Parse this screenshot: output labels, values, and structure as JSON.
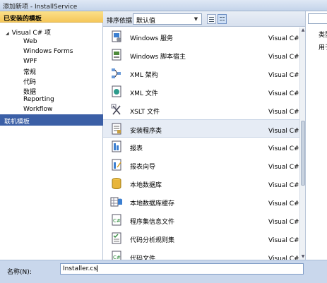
{
  "window": {
    "title": "添加新项 - InstallService"
  },
  "left_panel": {
    "installed_header": "已安装的模板",
    "root": "Visual C# 项",
    "children": [
      "Web",
      "Windows Forms",
      "WPF",
      "常规",
      "代码",
      "数据",
      "Reporting",
      "Workflow"
    ],
    "online": "联机模板"
  },
  "toolbar": {
    "sort_label": "排序依据:",
    "sort_value": "默认值"
  },
  "templates": [
    {
      "name": "Windows 服务",
      "type": "Visual C# 项",
      "icon": "windows-service-icon"
    },
    {
      "name": "Windows 脚本宿主",
      "type": "Visual C# 项",
      "icon": "script-host-icon"
    },
    {
      "name": "XML 架构",
      "type": "Visual C# 项",
      "icon": "xml-schema-icon"
    },
    {
      "name": "XML 文件",
      "type": "Visual C# 项",
      "icon": "xml-file-icon"
    },
    {
      "name": "XSLT 文件",
      "type": "Visual C# 项",
      "icon": "xslt-file-icon"
    },
    {
      "name": "安装程序类",
      "type": "Visual C# 项",
      "icon": "installer-class-icon",
      "selected": true
    },
    {
      "name": "报表",
      "type": "Visual C# 项",
      "icon": "report-icon"
    },
    {
      "name": "报表向导",
      "type": "Visual C# 项",
      "icon": "report-wizard-icon"
    },
    {
      "name": "本地数据库",
      "type": "Visual C# 项",
      "icon": "local-database-icon"
    },
    {
      "name": "本地数据库缓存",
      "type": "Visual C# 项",
      "icon": "database-cache-icon"
    },
    {
      "name": "程序集信息文件",
      "type": "Visual C# 项",
      "icon": "assembly-info-icon"
    },
    {
      "name": "代码分析规则集",
      "type": "Visual C# 项",
      "icon": "ruleset-icon"
    },
    {
      "name": "代码文件",
      "type": "Visual C# 项",
      "icon": "code-file-icon"
    }
  ],
  "right_panel": {
    "type_label": "类型",
    "desc_label": "用于"
  },
  "bottom": {
    "name_label": "名称(N):",
    "name_value": "Installer.cs"
  },
  "colors": {
    "selection": "#3b5fa6",
    "header": "#f5c75a"
  }
}
